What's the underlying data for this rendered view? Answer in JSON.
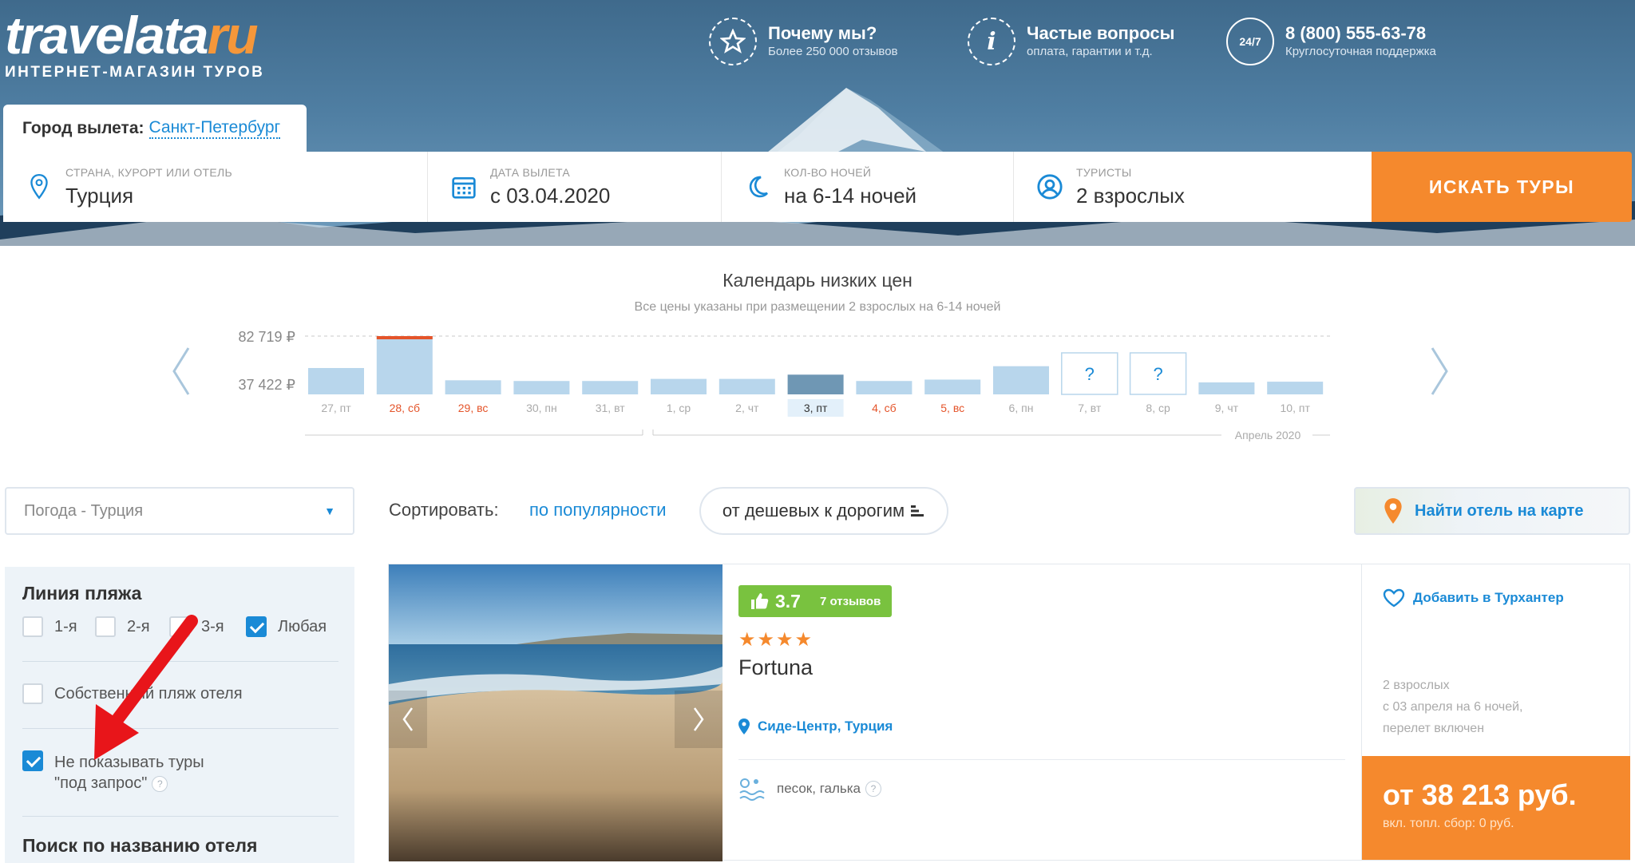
{
  "logo": {
    "main": "travelata",
    "suffix": "ru",
    "tagline": "ИНТЕРНЕТ-МАГАЗИН ТУРОВ"
  },
  "header": {
    "why": {
      "title": "Почему мы?",
      "sub": "Более 250 000 отзывов"
    },
    "faq": {
      "title": "Частые вопросы",
      "sub": "оплата, гарантии и т.д."
    },
    "phone": {
      "badge": "24/7",
      "title": "8 (800) 555-63-78",
      "sub": "Круглосуточная поддержка"
    }
  },
  "departure": {
    "label": "Город вылета:",
    "city": "Санкт-Петербург"
  },
  "search": {
    "destination": {
      "label": "Страна, курорт или отель",
      "value": "Турция"
    },
    "date": {
      "label": "Дата вылета",
      "value": "с 03.04.2020"
    },
    "nights": {
      "label": "Кол-во ночей",
      "value": "на 6-14 ночей"
    },
    "tourists": {
      "label": "Туристы",
      "value": "2 взрослых"
    },
    "button": "ИСКАТЬ ТУРЫ"
  },
  "calendar": {
    "title": "Календарь низких цен",
    "subtitle": "Все цены указаны при размещении 2 взрослых на 6-14 ночей",
    "month_label": "Апрель 2020",
    "unknown_mark": "?",
    "colors": {
      "bar": "#b8d6ec",
      "selected": "#6f97b4",
      "max": "#e4542a",
      "weekend": "#e4542a"
    }
  },
  "chart_data": {
    "type": "bar",
    "title": "Календарь низких цен",
    "y_tick_labels": [
      "82 719 ₽",
      "37 422 ₽"
    ],
    "y_ticks": [
      82719,
      37422
    ],
    "categories": [
      "27, пт",
      "28, сб",
      "29, вс",
      "30, пн",
      "31, вт",
      "1, ср",
      "2, чт",
      "3, пт",
      "4, сб",
      "5, вс",
      "6, пн",
      "7, вт",
      "8, ср",
      "9, чт",
      "10, пт"
    ],
    "values": [
      37422,
      82719,
      20000,
      19000,
      19000,
      22000,
      22000,
      28000,
      19000,
      21000,
      40000,
      null,
      null,
      17000,
      18000
    ],
    "weekend": [
      false,
      true,
      true,
      false,
      false,
      false,
      false,
      false,
      true,
      true,
      false,
      false,
      false,
      false,
      false
    ],
    "selected_index": 7,
    "max_index": 1,
    "grid": true
  },
  "filters": {
    "weather": "Погода - Турция"
  },
  "sort": {
    "label": "Сортировать:",
    "popularity": "по популярности",
    "price": "от дешевых к дорогим"
  },
  "map_button": "Найти отель на карте",
  "sidebar": {
    "beach_line": {
      "title": "Линия пляжа",
      "options": [
        {
          "label": "1-я",
          "checked": false
        },
        {
          "label": "2-я",
          "checked": false
        },
        {
          "label": "3-я",
          "checked": false
        },
        {
          "label": "Любая",
          "checked": true
        }
      ]
    },
    "own_beach": {
      "label": "Собственный пляж отеля",
      "checked": false
    },
    "no_request": {
      "line1": "Не показывать туры",
      "line2": "\"под запрос\"",
      "help": "?",
      "checked": true
    },
    "search_title": "Поиск по названию отеля"
  },
  "hotel": {
    "rating": "3.7",
    "reviews": "7 отзывов",
    "stars": "★★★★",
    "name": "Fortuna",
    "location": "Сиде-Центр, Турция",
    "beach": "песок, галька",
    "help": "?",
    "favorite": "Добавить в Турхантер",
    "details": [
      "2 взрослых",
      "с 03 апреля на 6 ночей,",
      "перелет включен"
    ],
    "price": "от 38 213 руб.",
    "price_note": "вкл. топл. сбор: 0 руб."
  }
}
